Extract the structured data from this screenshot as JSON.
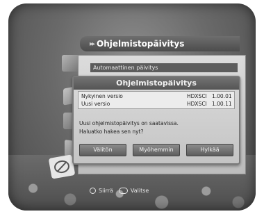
{
  "header": {
    "arrows": "▸▸",
    "title": "Ohjelmistopäivitys"
  },
  "menu": {
    "selected_item": "Automaattinen päivitys"
  },
  "dialog": {
    "title": "Ohjelmistopäivitys",
    "info": [
      {
        "label": "Nykyinen versio",
        "value": "HDXSCI",
        "version": "1.00.01"
      },
      {
        "label": "Uusi versio",
        "value": "HDXSCI",
        "version": "1.00.11"
      }
    ],
    "message_line1": "Uusi ohjelmistopäivitys on saatavissa.",
    "message_line2": "Haluatko hakea sen nyt?",
    "buttons": {
      "now": "Välitön",
      "later": "Myöhemmin",
      "reject": "Hylkää"
    }
  },
  "hint": {
    "move": "Siirrä",
    "select": "Valitse"
  }
}
